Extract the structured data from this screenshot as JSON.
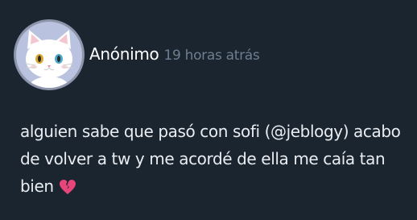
{
  "post": {
    "author": "Anónimo",
    "timestamp": "19 horas atrás",
    "text_before_mention": "alguien sabe que pasó con sofi (",
    "mention": "@jeblogy",
    "text_after_mention": ") acabo de volver a tw y me acordé de ella me caía tan bien",
    "emoji": "broken-heart-icon"
  },
  "colors": {
    "background": "#1b2530",
    "author": "#ffffff",
    "timestamp": "#6e7e8e",
    "text": "#e9edf1",
    "avatar_bg": "#b9c2de",
    "emoji": "#e8467a"
  }
}
